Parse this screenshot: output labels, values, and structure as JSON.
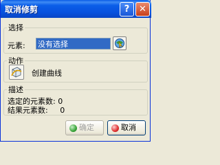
{
  "window": {
    "title": "取消修剪",
    "help_label": "?",
    "close_label": "✕"
  },
  "selection": {
    "legend": "选择",
    "element_label": "元素:",
    "element_value": "没有选择",
    "picker_icon": "element-picker-icon"
  },
  "action": {
    "legend": "动作",
    "icon": "create-curve-icon",
    "label": "创建曲线"
  },
  "description": {
    "legend": "描述",
    "selected_count_label": "选定的元素数:",
    "selected_count": "0",
    "result_count_label": "结果元素数:",
    "result_count": "0"
  },
  "buttons": {
    "ok_label": "确定",
    "ok_enabled": false,
    "cancel_label": "取消"
  },
  "colors": {
    "titlebar": "#0a5de6",
    "selection_highlight": "#316ac5",
    "background": "#ece9d8"
  }
}
